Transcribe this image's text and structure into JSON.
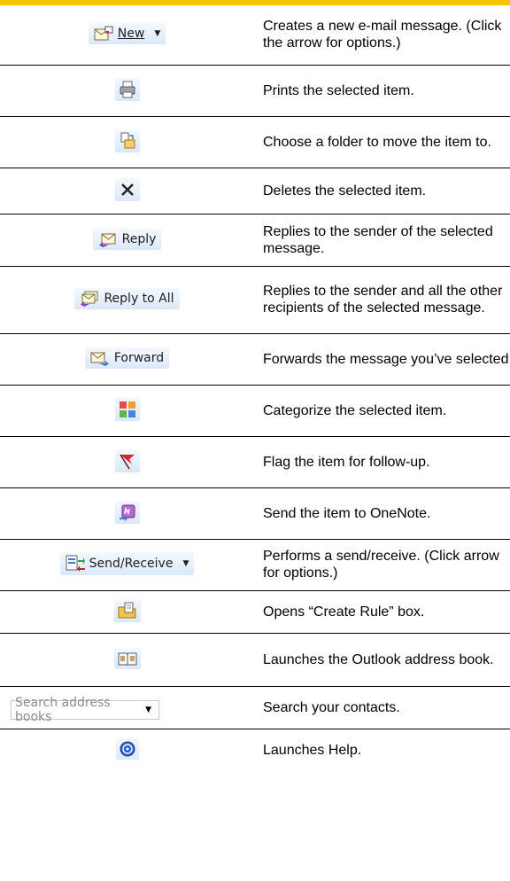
{
  "rows": [
    {
      "icon": "new-mail-icon",
      "label": "New",
      "has_arrow": true,
      "desc": "Creates a new e-mail message. (Click the arrow for options.)"
    },
    {
      "icon": "printer-icon",
      "desc": "Prints the selected item."
    },
    {
      "icon": "move-to-folder-icon",
      "desc": "Choose a folder to move the item to."
    },
    {
      "icon": "delete-x-icon",
      "desc": "Deletes the selected item."
    },
    {
      "icon": "reply-icon",
      "label": "Reply",
      "desc": "Replies to the sender of the selected message."
    },
    {
      "icon": "reply-all-icon",
      "label": "Reply to All",
      "desc": "Replies to the sender and all the other recipients of the selected message."
    },
    {
      "icon": "forward-icon",
      "label": "Forward",
      "desc": "Forwards the message you’ve selected."
    },
    {
      "icon": "categorize-icon",
      "desc": "Categorize the selected item."
    },
    {
      "icon": "flag-icon",
      "desc": "Flag the item for follow-up."
    },
    {
      "icon": "onenote-icon",
      "desc": "Send the item to OneNote."
    },
    {
      "icon": "send-receive-icon",
      "label": "Send/Receive",
      "has_arrow": true,
      "desc": "Performs a send/receive. (Click arrow for options.)"
    },
    {
      "icon": "create-rule-icon",
      "desc": "Opens “Create Rule” box."
    },
    {
      "icon": "address-book-icon",
      "desc": "Launches the Outlook address book."
    },
    {
      "icon": "search-dropdown",
      "search_placeholder": "Search address books",
      "desc": "Search your contacts."
    },
    {
      "icon": "help-icon",
      "desc": "Launches Help."
    }
  ]
}
